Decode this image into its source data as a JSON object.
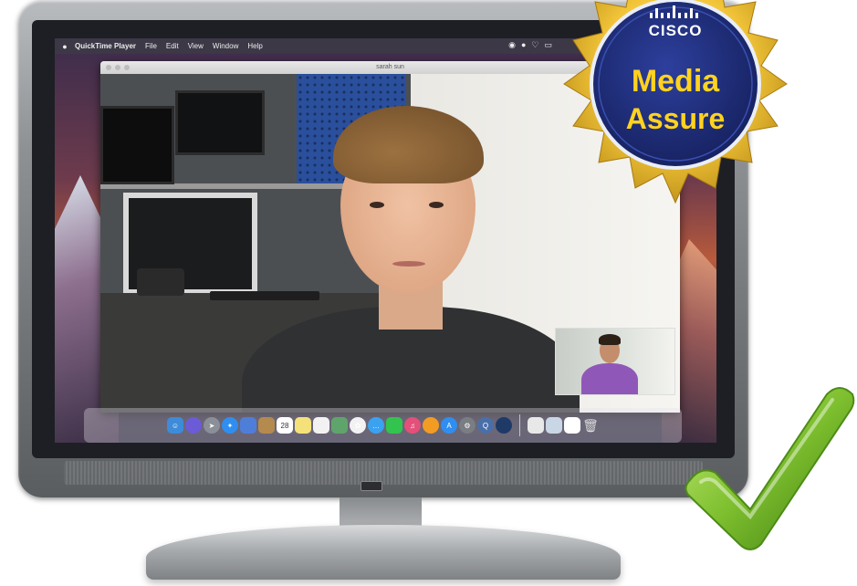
{
  "menubar": {
    "apple": "",
    "app_name": "QuickTime Player",
    "menus": [
      "File",
      "Edit",
      "View",
      "Window",
      "Help"
    ]
  },
  "qt_window": {
    "title": "sarah sun"
  },
  "dock": {
    "calendar_day": "28"
  },
  "badge": {
    "brand": "CISCO",
    "line1": "Media",
    "line2": "Assure"
  },
  "colors": {
    "badge_gold": "#f3c63a",
    "badge_navy": "#1d2b7a",
    "badge_text_yellow": "#ffd21f",
    "check_green": "#7dbf2e"
  }
}
